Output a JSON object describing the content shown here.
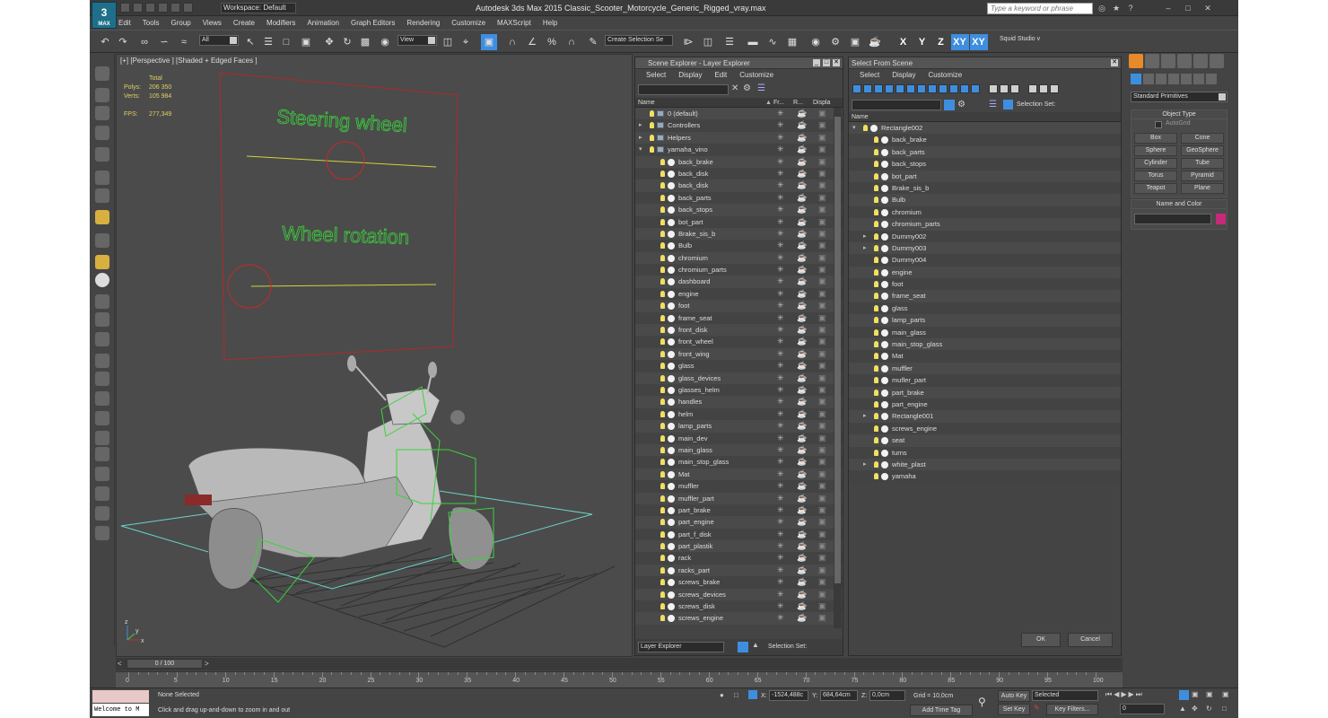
{
  "app": {
    "title": "Autodesk 3ds Max  2015    Classic_Scooter_Motorcycle_Generic_Rigged_vray.max",
    "logo_label": "MAX",
    "workspace": "Workspace: Default",
    "search_placeholder": "Type a keyword or phrase"
  },
  "menu": [
    "Edit",
    "Tools",
    "Group",
    "Views",
    "Create",
    "Modifiers",
    "Animation",
    "Graph Editors",
    "Rendering",
    "Customize",
    "MAXScript",
    "Help"
  ],
  "toolbar": {
    "selection_filter": "All",
    "reference_coord": "View",
    "named_selection": "Create Selection Se",
    "axes": [
      "X",
      "Y",
      "Z",
      "XY",
      "XY"
    ],
    "studio_label": "Squid Studio v"
  },
  "viewport": {
    "label": "[+] [Perspective ] [Shaded + Edged Faces ]",
    "stats": {
      "total_label": "Total",
      "polys_label": "Polys:",
      "polys": "206 350",
      "verts_label": "Verts:",
      "verts": "105 984",
      "fps_label": "FPS:",
      "fps": "277,349"
    },
    "rig_text_1": "Steering wheel",
    "rig_text_2": "Wheel rotation",
    "axis_labels": {
      "x": "x",
      "y": "y",
      "z": "z"
    }
  },
  "scene_explorer": {
    "title": "Scene Explorer - Layer Explorer",
    "menu": [
      "Select",
      "Display",
      "Edit",
      "Customize"
    ],
    "columns": {
      "name": "Name",
      "frozen": "Fr...",
      "render": "R...",
      "display": "Displa"
    },
    "layers": [
      {
        "name": "0 (default)",
        "level": 0,
        "type": "layer"
      },
      {
        "name": "Controllers",
        "level": 0,
        "type": "layer",
        "collapsed": true
      },
      {
        "name": "Helpers",
        "level": 0,
        "type": "layer",
        "collapsed": true
      },
      {
        "name": "yamaha_vino",
        "level": 0,
        "type": "layer",
        "expanded": true
      },
      {
        "name": "back_brake",
        "level": 1,
        "type": "object"
      },
      {
        "name": "back_disk",
        "level": 1,
        "type": "object"
      },
      {
        "name": "back_disk",
        "level": 1,
        "type": "object"
      },
      {
        "name": "back_parts",
        "level": 1,
        "type": "object"
      },
      {
        "name": "back_stops",
        "level": 1,
        "type": "object"
      },
      {
        "name": "bot_part",
        "level": 1,
        "type": "object"
      },
      {
        "name": "Brake_sis_b",
        "level": 1,
        "type": "object"
      },
      {
        "name": "Bulb",
        "level": 1,
        "type": "object"
      },
      {
        "name": "chromium",
        "level": 1,
        "type": "object"
      },
      {
        "name": "chromium_parts",
        "level": 1,
        "type": "object"
      },
      {
        "name": "dashboard",
        "level": 1,
        "type": "object"
      },
      {
        "name": "engine",
        "level": 1,
        "type": "object"
      },
      {
        "name": "foot",
        "level": 1,
        "type": "object"
      },
      {
        "name": "frame_seat",
        "level": 1,
        "type": "object"
      },
      {
        "name": "front_disk",
        "level": 1,
        "type": "object"
      },
      {
        "name": "front_wheel",
        "level": 1,
        "type": "object"
      },
      {
        "name": "front_wing",
        "level": 1,
        "type": "object"
      },
      {
        "name": "glass",
        "level": 1,
        "type": "object"
      },
      {
        "name": "glass_devices",
        "level": 1,
        "type": "object"
      },
      {
        "name": "glasses_helm",
        "level": 1,
        "type": "object"
      },
      {
        "name": "handles",
        "level": 1,
        "type": "object"
      },
      {
        "name": "helm",
        "level": 1,
        "type": "object"
      },
      {
        "name": "lamp_parts",
        "level": 1,
        "type": "object"
      },
      {
        "name": "main_dev",
        "level": 1,
        "type": "object"
      },
      {
        "name": "main_glass",
        "level": 1,
        "type": "object"
      },
      {
        "name": "main_stop_glass",
        "level": 1,
        "type": "object"
      },
      {
        "name": "Mat",
        "level": 1,
        "type": "object"
      },
      {
        "name": "muffler",
        "level": 1,
        "type": "object"
      },
      {
        "name": "muffler_part",
        "level": 1,
        "type": "object"
      },
      {
        "name": "part_brake",
        "level": 1,
        "type": "object"
      },
      {
        "name": "part_engine",
        "level": 1,
        "type": "object"
      },
      {
        "name": "part_f_disk",
        "level": 1,
        "type": "object"
      },
      {
        "name": "part_plastik",
        "level": 1,
        "type": "object"
      },
      {
        "name": "rack",
        "level": 1,
        "type": "object"
      },
      {
        "name": "racks_part",
        "level": 1,
        "type": "object"
      },
      {
        "name": "screws_brake",
        "level": 1,
        "type": "object"
      },
      {
        "name": "screws_devices",
        "level": 1,
        "type": "object"
      },
      {
        "name": "screws_disk",
        "level": 1,
        "type": "object"
      },
      {
        "name": "screws_engine",
        "level": 1,
        "type": "object"
      }
    ],
    "footer_select": "Layer Explorer",
    "selection_set_label": "Selection Set:"
  },
  "select_from_scene": {
    "title": "Select From Scene",
    "menu": [
      "Select",
      "Display",
      "Customize"
    ],
    "selection_set_label": "Selection Set:",
    "column_name": "Name",
    "items": [
      {
        "name": "Rectangle002",
        "level": 0,
        "expanded": true
      },
      {
        "name": "back_brake",
        "level": 1
      },
      {
        "name": "back_parts",
        "level": 1
      },
      {
        "name": "back_stops",
        "level": 1
      },
      {
        "name": "bot_part",
        "level": 1
      },
      {
        "name": "Brake_sis_b",
        "level": 1
      },
      {
        "name": "Bulb",
        "level": 1
      },
      {
        "name": "chromium",
        "level": 1
      },
      {
        "name": "chromium_parts",
        "level": 1
      },
      {
        "name": "Dummy002",
        "level": 1,
        "collapsed": true
      },
      {
        "name": "Dummy003",
        "level": 1,
        "collapsed": true
      },
      {
        "name": "Dummy004",
        "level": 1
      },
      {
        "name": "engine",
        "level": 1
      },
      {
        "name": "foot",
        "level": 1
      },
      {
        "name": "frame_seat",
        "level": 1
      },
      {
        "name": "glass",
        "level": 1
      },
      {
        "name": "lamp_parts",
        "level": 1
      },
      {
        "name": "main_glass",
        "level": 1
      },
      {
        "name": "main_stop_glass",
        "level": 1
      },
      {
        "name": "Mat",
        "level": 1
      },
      {
        "name": "muffler",
        "level": 1
      },
      {
        "name": "mufler_part",
        "level": 1
      },
      {
        "name": "part_brake",
        "level": 1
      },
      {
        "name": "part_engine",
        "level": 1
      },
      {
        "name": "Rectangle001",
        "level": 1,
        "collapsed": true
      },
      {
        "name": "screws_engine",
        "level": 1
      },
      {
        "name": "seat",
        "level": 1
      },
      {
        "name": "turns",
        "level": 1
      },
      {
        "name": "white_plast",
        "level": 1,
        "collapsed": true
      },
      {
        "name": "yamaha",
        "level": 1
      }
    ],
    "ok": "OK",
    "cancel": "Cancel"
  },
  "command_panel": {
    "category": "Standard Primitives",
    "object_type_title": "Object Type",
    "autogrid": "AutoGrid",
    "buttons": [
      "Box",
      "Cone",
      "Sphere",
      "GeoSphere",
      "Cylinder",
      "Tube",
      "Torus",
      "Pyramid",
      "Teapot",
      "Plane"
    ],
    "name_color_title": "Name and Color",
    "object_color": "#c8287a"
  },
  "timeline": {
    "frame_display": "0 / 100",
    "ticks": [
      "0",
      "5",
      "10",
      "15",
      "20",
      "25",
      "30",
      "35",
      "40",
      "45",
      "50",
      "55",
      "60",
      "65",
      "70",
      "75",
      "80",
      "85",
      "90",
      "95",
      "100"
    ]
  },
  "status": {
    "maxscript": "Welcome to M",
    "selection": "None Selected",
    "prompt": "Click and drag up-and-down to zoom in and out",
    "x_label": "X:",
    "x": "-1524,488c",
    "y_label": "Y:",
    "y": "684,64cm",
    "z_label": "Z:",
    "z": "0,0cm",
    "grid": "Grid = 10,0cm",
    "add_time_tag": "Add Time Tag",
    "auto_key": "Auto Key",
    "set_key": "Set Key",
    "key_mode": "Selected",
    "key_filters": "Key Filters...",
    "frame": "0"
  },
  "colors": {
    "accent": "#3e8ee0",
    "wire_green": "#3cd23c",
    "rig_red": "#c82828"
  }
}
